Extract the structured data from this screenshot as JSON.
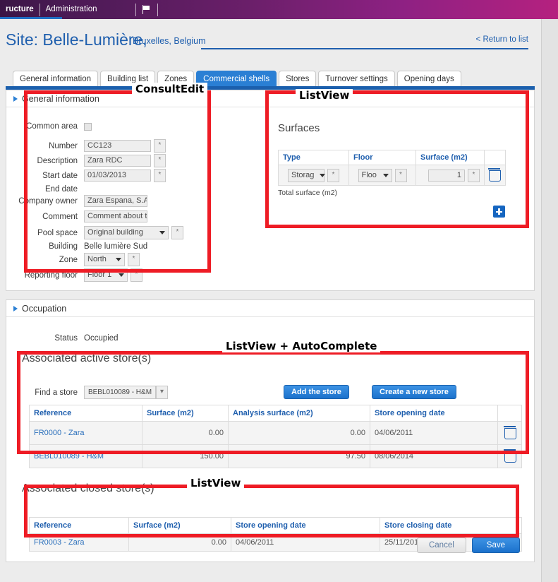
{
  "topbar": {
    "items": [
      {
        "label": "ructure",
        "active": true
      },
      {
        "label": "Administration",
        "active": false
      }
    ],
    "flag_icon": "flag-icon",
    "gradient_from": "#3a1545",
    "gradient_to": "#b5217f"
  },
  "header": {
    "title": "Site: Belle-Lumière,",
    "subtitle": "Bruxelles, Belgium",
    "return_link": "< Return to list",
    "accent": "#1f5fae"
  },
  "tabs": [
    {
      "label": "General information",
      "active": false
    },
    {
      "label": "Building list",
      "active": false
    },
    {
      "label": "Zones",
      "active": false
    },
    {
      "label": "Commercial shells",
      "active": true
    },
    {
      "label": "Stores",
      "active": false
    },
    {
      "label": "Turnover settings",
      "active": false
    },
    {
      "label": "Opening days",
      "active": false
    }
  ],
  "general_information": {
    "section_title": "General information",
    "chevron_icon": "chevron-right-icon",
    "fields": {
      "common_area": {
        "label": "Common area",
        "checked": false
      },
      "number": {
        "label": "Number",
        "value": "CC123",
        "required_marker": "*"
      },
      "description": {
        "label": "Description",
        "value": "Zara RDC",
        "required_marker": "*"
      },
      "start_date": {
        "label": "Start date",
        "value": "01/03/2013",
        "required_marker": "*"
      },
      "end_date": {
        "label": "End date",
        "value": ""
      },
      "company_owner": {
        "label": "Company owner",
        "value": "Zara Espana, S.A."
      },
      "comment": {
        "label": "Comment",
        "value": "Comment about the cc"
      },
      "pool_space": {
        "label": "Pool space",
        "value": "Original building",
        "required_marker": "*"
      },
      "building": {
        "label": "Building",
        "value": "Belle lumière Sud"
      },
      "zone": {
        "label": "Zone",
        "value": "North",
        "required_marker": "*"
      },
      "reporting_floor": {
        "label": "Reporting floor",
        "value": "Floor 1",
        "required_marker": "*"
      }
    }
  },
  "surfaces": {
    "title": "Surfaces",
    "columns": [
      "Type",
      "Floor",
      "Surface (m2)",
      ""
    ],
    "rows": [
      {
        "type": "Storag",
        "floor": "Floo",
        "surface": "1",
        "delete_icon": "trash-icon"
      }
    ],
    "total_label": "Total surface (m2)",
    "add_icon": "plus-icon"
  },
  "occupation": {
    "section_title": "Occupation",
    "chevron_icon": "chevron-right-icon",
    "status_label": "Status",
    "status_value": "Occupied",
    "active_title": "Associated active store(s)",
    "find_label": "Find a store",
    "find_value": "BEBL010089 - H&M",
    "add_button": "Add the store",
    "create_button": "Create a new store",
    "active_columns": [
      "Reference",
      "Surface (m2)",
      "Analysis surface (m2)",
      "Store opening date",
      ""
    ],
    "active_rows": [
      {
        "reference": "FR0000 - Zara",
        "surface": "0.00",
        "analysis_surface": "0.00",
        "opening_date": "04/06/2011",
        "delete_icon": "trash-icon"
      },
      {
        "reference": "BEBL010089 - H&M",
        "surface": "150.00",
        "analysis_surface": "97.50",
        "opening_date": "08/06/2014",
        "delete_icon": "trash-icon"
      }
    ],
    "closed_title": "Associated closed store(s)",
    "closed_columns": [
      "Reference",
      "Surface (m2)",
      "Store opening date",
      "Store closing date"
    ],
    "closed_rows": [
      {
        "reference": "FR0003 - Zara",
        "surface": "0.00",
        "opening_date": "04/06/2011",
        "closing_date": "25/11/2013"
      }
    ]
  },
  "footer": {
    "cancel_label": "Cancel",
    "save_label": "Save"
  },
  "annotations": [
    {
      "id": "consultedit",
      "label": "ConsultEdit"
    },
    {
      "id": "listview_surfaces",
      "label": "ListView"
    },
    {
      "id": "listview_autocomplete",
      "label": "ListView + AutoComplete"
    },
    {
      "id": "listview_closed",
      "label": "ListView"
    }
  ],
  "colors": {
    "annotation_red": "#ee1c25",
    "link_blue": "#1f5fae",
    "tab_active": "#2a7fd4",
    "button_blue": "#1b71cc"
  }
}
